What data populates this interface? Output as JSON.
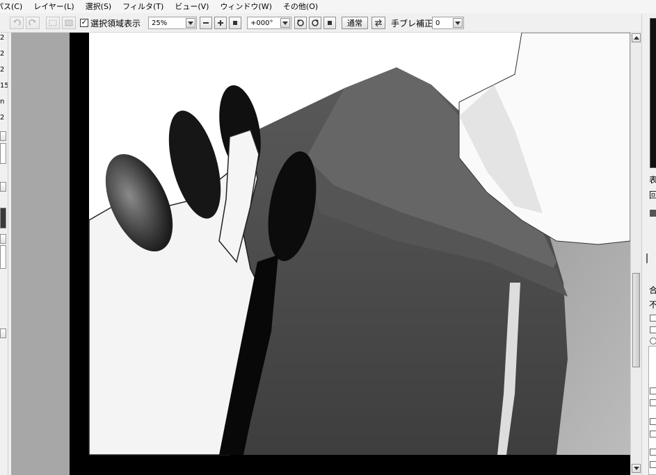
{
  "menubar": {
    "items": [
      "パス(C)",
      "レイヤー(L)",
      "選択(S)",
      "フィルタ(T)",
      "ビュー(V)",
      "ウィンドウ(W)",
      "その他(O)"
    ]
  },
  "toolbar": {
    "selection_display_label": "選択領域表示",
    "zoom_value": "25%",
    "rotation_value": "+000°",
    "blend_mode_label": "通常",
    "stabilizer_label": "手ブレ補正",
    "stabilizer_value": "0"
  },
  "left_panel": {
    "numbers": [
      "2",
      "2",
      "2",
      "15",
      "n",
      "2"
    ]
  },
  "right_panel": {
    "labels": [
      "表",
      "回",
      "合",
      "不"
    ]
  },
  "colors": {
    "canvas_bg": "#a7a7a7",
    "panel_bg": "#f0f0f0"
  }
}
